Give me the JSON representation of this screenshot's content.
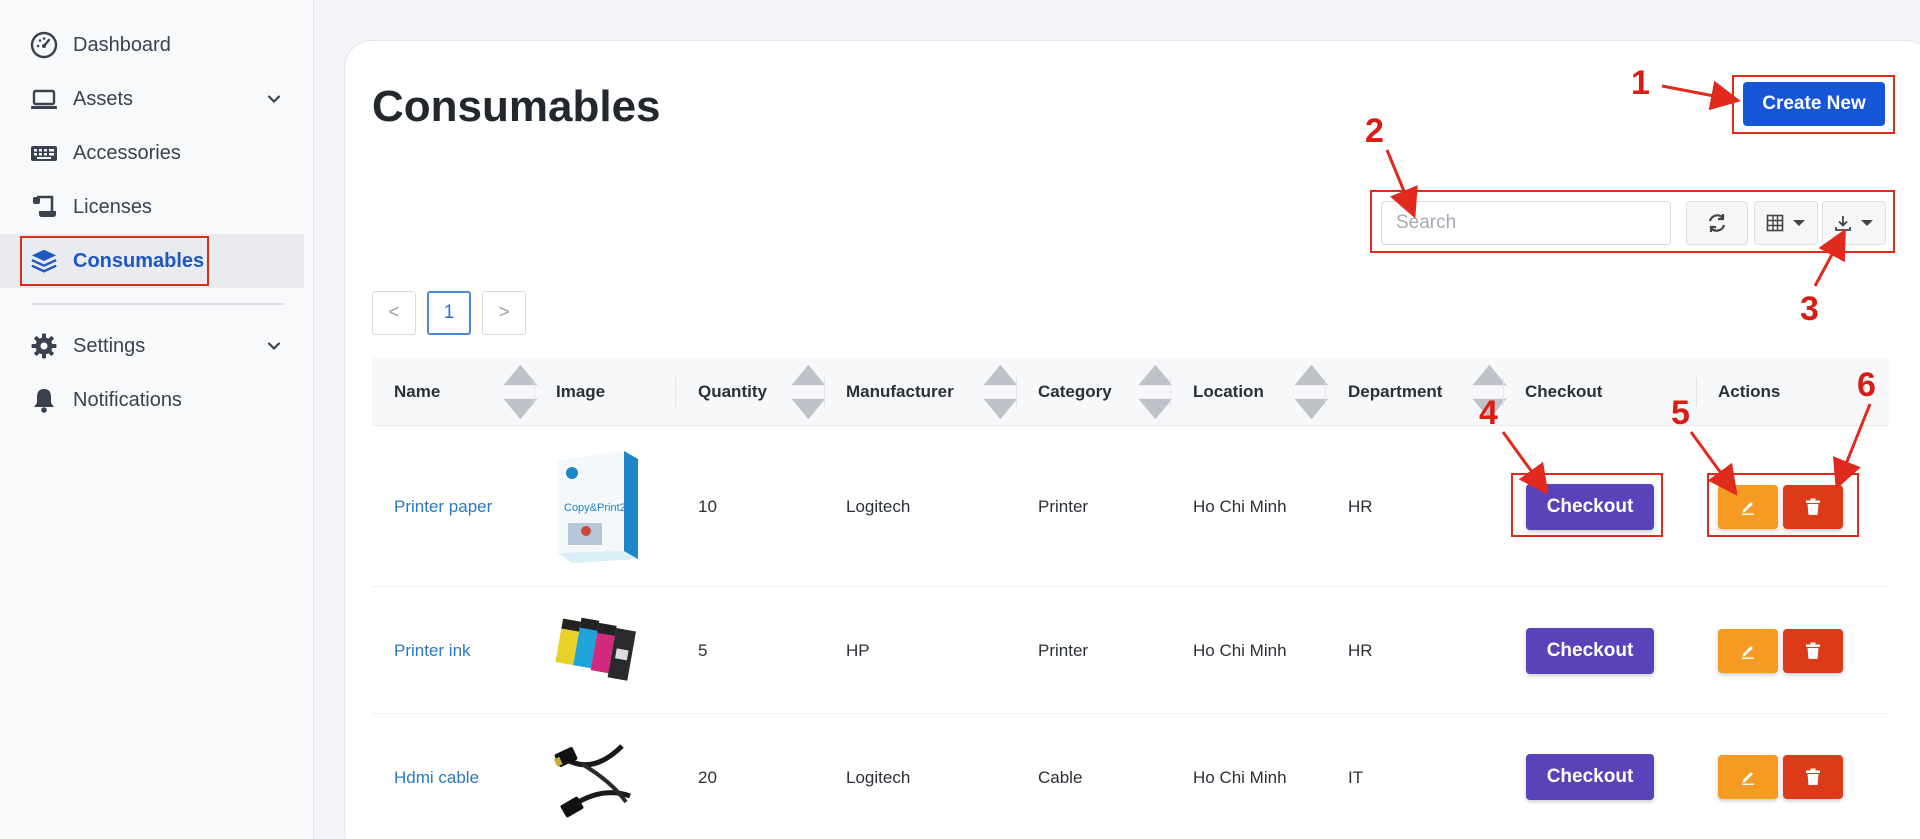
{
  "sidebar": {
    "items": [
      {
        "label": "Dashboard",
        "icon": "gauge-icon",
        "active": false
      },
      {
        "label": "Assets",
        "icon": "laptop-icon",
        "active": false,
        "has_submenu": true
      },
      {
        "label": "Accessories",
        "icon": "keyboard-icon",
        "active": false
      },
      {
        "label": "Licenses",
        "icon": "scroll-icon",
        "active": false
      },
      {
        "label": "Consumables",
        "icon": "layers-icon",
        "active": true
      },
      {
        "label": "Settings",
        "icon": "gear-icon",
        "active": false,
        "has_submenu": true
      },
      {
        "label": "Notifications",
        "icon": "bell-icon",
        "active": false
      }
    ]
  },
  "main": {
    "title": "Consumables",
    "create_button": "Create New",
    "search_placeholder": "Search",
    "pagination": {
      "prev": "<",
      "current": "1",
      "next": ">"
    }
  },
  "table": {
    "columns": [
      "Name",
      "Image",
      "Quantity",
      "Manufacturer",
      "Category",
      "Location",
      "Department",
      "Checkout",
      "Actions"
    ],
    "rows": [
      {
        "name": "Printer paper",
        "quantity": "10",
        "manufacturer": "Logitech",
        "category": "Printer",
        "location": "Ho Chi Minh",
        "department": "HR",
        "checkout": "Checkout",
        "image_text": "Copy&Print20"
      },
      {
        "name": "Printer ink",
        "quantity": "5",
        "manufacturer": "HP",
        "category": "Printer",
        "location": "Ho Chi Minh",
        "department": "HR",
        "checkout": "Checkout"
      },
      {
        "name": "Hdmi cable",
        "quantity": "20",
        "manufacturer": "Logitech",
        "category": "Cable",
        "location": "Ho Chi Minh",
        "department": "IT",
        "checkout": "Checkout"
      }
    ]
  },
  "annotations": [
    "1",
    "2",
    "3",
    "4",
    "5",
    "6"
  ],
  "colors": {
    "primary": "#1555d6",
    "checkout": "#5a43b8",
    "edit": "#f59a23",
    "delete": "#dd3a1a",
    "link": "#2a78c2",
    "annotation": "#e02a1e"
  }
}
